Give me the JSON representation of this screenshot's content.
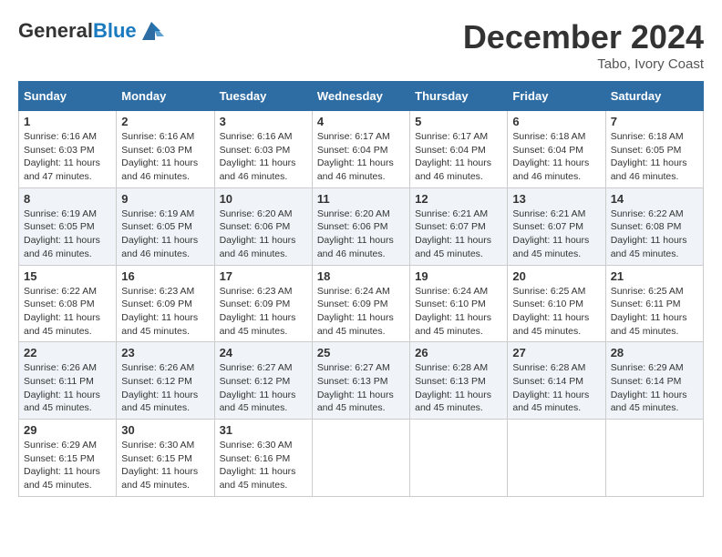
{
  "header": {
    "logo_general": "General",
    "logo_blue": "Blue",
    "month": "December 2024",
    "location": "Tabo, Ivory Coast"
  },
  "days_of_week": [
    "Sunday",
    "Monday",
    "Tuesday",
    "Wednesday",
    "Thursday",
    "Friday",
    "Saturday"
  ],
  "weeks": [
    [
      {
        "day": "1",
        "sunrise": "6:16 AM",
        "sunset": "6:03 PM",
        "daylight": "11 hours and 47 minutes."
      },
      {
        "day": "2",
        "sunrise": "6:16 AM",
        "sunset": "6:03 PM",
        "daylight": "11 hours and 46 minutes."
      },
      {
        "day": "3",
        "sunrise": "6:16 AM",
        "sunset": "6:03 PM",
        "daylight": "11 hours and 46 minutes."
      },
      {
        "day": "4",
        "sunrise": "6:17 AM",
        "sunset": "6:04 PM",
        "daylight": "11 hours and 46 minutes."
      },
      {
        "day": "5",
        "sunrise": "6:17 AM",
        "sunset": "6:04 PM",
        "daylight": "11 hours and 46 minutes."
      },
      {
        "day": "6",
        "sunrise": "6:18 AM",
        "sunset": "6:04 PM",
        "daylight": "11 hours and 46 minutes."
      },
      {
        "day": "7",
        "sunrise": "6:18 AM",
        "sunset": "6:05 PM",
        "daylight": "11 hours and 46 minutes."
      }
    ],
    [
      {
        "day": "8",
        "sunrise": "6:19 AM",
        "sunset": "6:05 PM",
        "daylight": "11 hours and 46 minutes."
      },
      {
        "day": "9",
        "sunrise": "6:19 AM",
        "sunset": "6:05 PM",
        "daylight": "11 hours and 46 minutes."
      },
      {
        "day": "10",
        "sunrise": "6:20 AM",
        "sunset": "6:06 PM",
        "daylight": "11 hours and 46 minutes."
      },
      {
        "day": "11",
        "sunrise": "6:20 AM",
        "sunset": "6:06 PM",
        "daylight": "11 hours and 46 minutes."
      },
      {
        "day": "12",
        "sunrise": "6:21 AM",
        "sunset": "6:07 PM",
        "daylight": "11 hours and 45 minutes."
      },
      {
        "day": "13",
        "sunrise": "6:21 AM",
        "sunset": "6:07 PM",
        "daylight": "11 hours and 45 minutes."
      },
      {
        "day": "14",
        "sunrise": "6:22 AM",
        "sunset": "6:08 PM",
        "daylight": "11 hours and 45 minutes."
      }
    ],
    [
      {
        "day": "15",
        "sunrise": "6:22 AM",
        "sunset": "6:08 PM",
        "daylight": "11 hours and 45 minutes."
      },
      {
        "day": "16",
        "sunrise": "6:23 AM",
        "sunset": "6:09 PM",
        "daylight": "11 hours and 45 minutes."
      },
      {
        "day": "17",
        "sunrise": "6:23 AM",
        "sunset": "6:09 PM",
        "daylight": "11 hours and 45 minutes."
      },
      {
        "day": "18",
        "sunrise": "6:24 AM",
        "sunset": "6:09 PM",
        "daylight": "11 hours and 45 minutes."
      },
      {
        "day": "19",
        "sunrise": "6:24 AM",
        "sunset": "6:10 PM",
        "daylight": "11 hours and 45 minutes."
      },
      {
        "day": "20",
        "sunrise": "6:25 AM",
        "sunset": "6:10 PM",
        "daylight": "11 hours and 45 minutes."
      },
      {
        "day": "21",
        "sunrise": "6:25 AM",
        "sunset": "6:11 PM",
        "daylight": "11 hours and 45 minutes."
      }
    ],
    [
      {
        "day": "22",
        "sunrise": "6:26 AM",
        "sunset": "6:11 PM",
        "daylight": "11 hours and 45 minutes."
      },
      {
        "day": "23",
        "sunrise": "6:26 AM",
        "sunset": "6:12 PM",
        "daylight": "11 hours and 45 minutes."
      },
      {
        "day": "24",
        "sunrise": "6:27 AM",
        "sunset": "6:12 PM",
        "daylight": "11 hours and 45 minutes."
      },
      {
        "day": "25",
        "sunrise": "6:27 AM",
        "sunset": "6:13 PM",
        "daylight": "11 hours and 45 minutes."
      },
      {
        "day": "26",
        "sunrise": "6:28 AM",
        "sunset": "6:13 PM",
        "daylight": "11 hours and 45 minutes."
      },
      {
        "day": "27",
        "sunrise": "6:28 AM",
        "sunset": "6:14 PM",
        "daylight": "11 hours and 45 minutes."
      },
      {
        "day": "28",
        "sunrise": "6:29 AM",
        "sunset": "6:14 PM",
        "daylight": "11 hours and 45 minutes."
      }
    ],
    [
      {
        "day": "29",
        "sunrise": "6:29 AM",
        "sunset": "6:15 PM",
        "daylight": "11 hours and 45 minutes."
      },
      {
        "day": "30",
        "sunrise": "6:30 AM",
        "sunset": "6:15 PM",
        "daylight": "11 hours and 45 minutes."
      },
      {
        "day": "31",
        "sunrise": "6:30 AM",
        "sunset": "6:16 PM",
        "daylight": "11 hours and 45 minutes."
      },
      null,
      null,
      null,
      null
    ]
  ]
}
